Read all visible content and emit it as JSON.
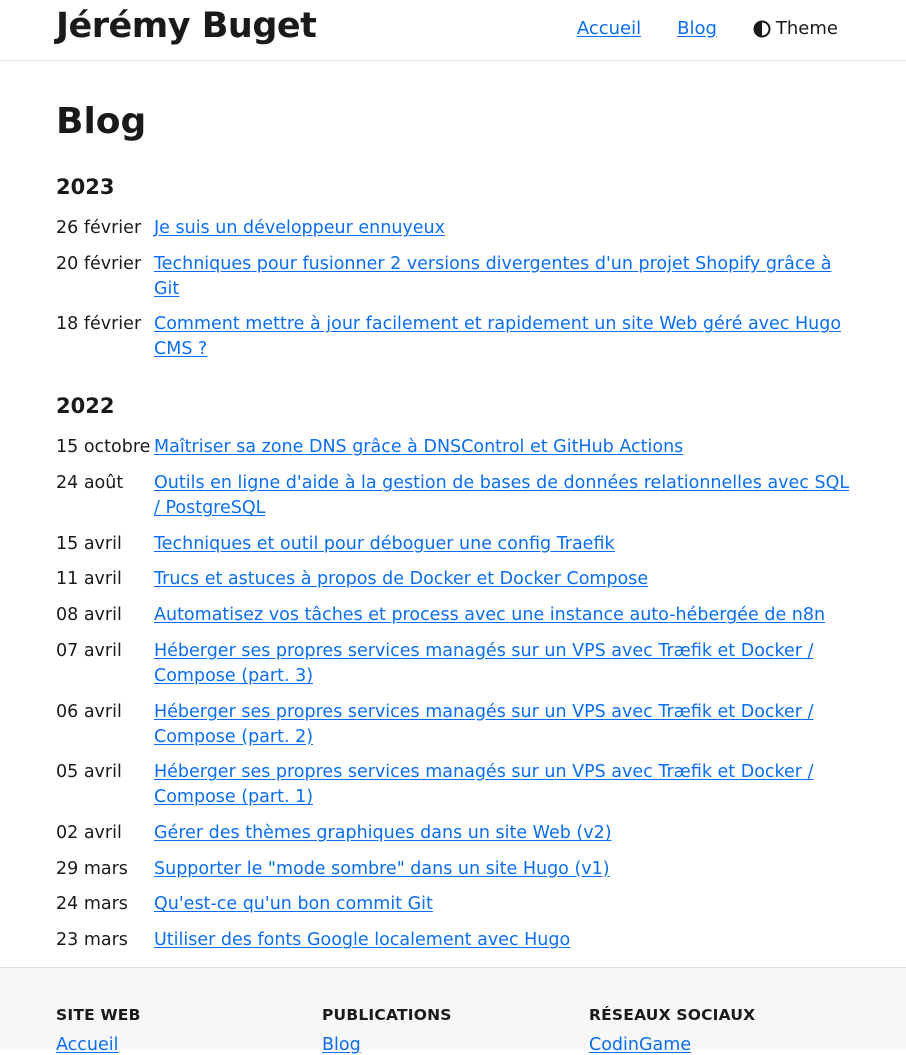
{
  "header": {
    "brand": "Jérémy Buget",
    "nav": [
      "Accueil",
      "Blog"
    ],
    "theme_label": "Theme",
    "theme_icon": "half-circle-contrast-icon"
  },
  "main": {
    "title": "Blog",
    "years": [
      {
        "year": "2023",
        "posts": [
          {
            "date": "26 février",
            "title": "Je suis un développeur ennuyeux"
          },
          {
            "date": "20 février",
            "title": "Techniques pour fusionner 2 versions divergentes d'un projet Shopify grâce à Git"
          },
          {
            "date": "18 février",
            "title": "Comment mettre à jour facilement et rapidement un site Web géré avec Hugo CMS ?"
          }
        ]
      },
      {
        "year": "2022",
        "posts": [
          {
            "date": "15 octobre",
            "title": "Maîtriser sa zone DNS grâce à DNSControl et GitHub Actions"
          },
          {
            "date": "24 août",
            "title": "Outils en ligne d'aide à la gestion de bases de données relationnelles avec SQL / PostgreSQL"
          },
          {
            "date": "15 avril",
            "title": "Techniques et outil pour déboguer une config Traefik"
          },
          {
            "date": "11 avril",
            "title": "Trucs et astuces à propos de Docker et Docker Compose"
          },
          {
            "date": "08 avril",
            "title": "Automatisez vos tâches et process avec une instance auto-hébergée de n8n"
          },
          {
            "date": "07 avril",
            "title": "Héberger ses propres services managés sur un VPS avec Træfik et Docker / Compose (part. 3)"
          },
          {
            "date": "06 avril",
            "title": "Héberger ses propres services managés sur un VPS avec Træfik et Docker / Compose (part. 2)"
          },
          {
            "date": "05 avril",
            "title": "Héberger ses propres services managés sur un VPS avec Træfik et Docker / Compose (part. 1)"
          },
          {
            "date": "02 avril",
            "title": "Gérer des thèmes graphiques dans un site Web (v2)"
          },
          {
            "date": "29 mars",
            "title": "Supporter le \"mode sombre\" dans un site Hugo (v1)"
          },
          {
            "date": "24 mars",
            "title": "Qu'est-ce qu'un bon commit Git"
          },
          {
            "date": "23 mars",
            "title": "Utiliser des fonts Google localement avec Hugo"
          }
        ]
      }
    ]
  },
  "footer": {
    "columns": [
      {
        "heading": "SITE WEB",
        "link": "Accueil"
      },
      {
        "heading": "PUBLICATIONS",
        "link": "Blog"
      },
      {
        "heading": "RÉSEAUX SOCIAUX",
        "link": "CodinGame"
      }
    ]
  },
  "colors": {
    "link": "#0b6ef0",
    "text": "#1a1a1a",
    "footer_bg": "#f7f7f7"
  }
}
